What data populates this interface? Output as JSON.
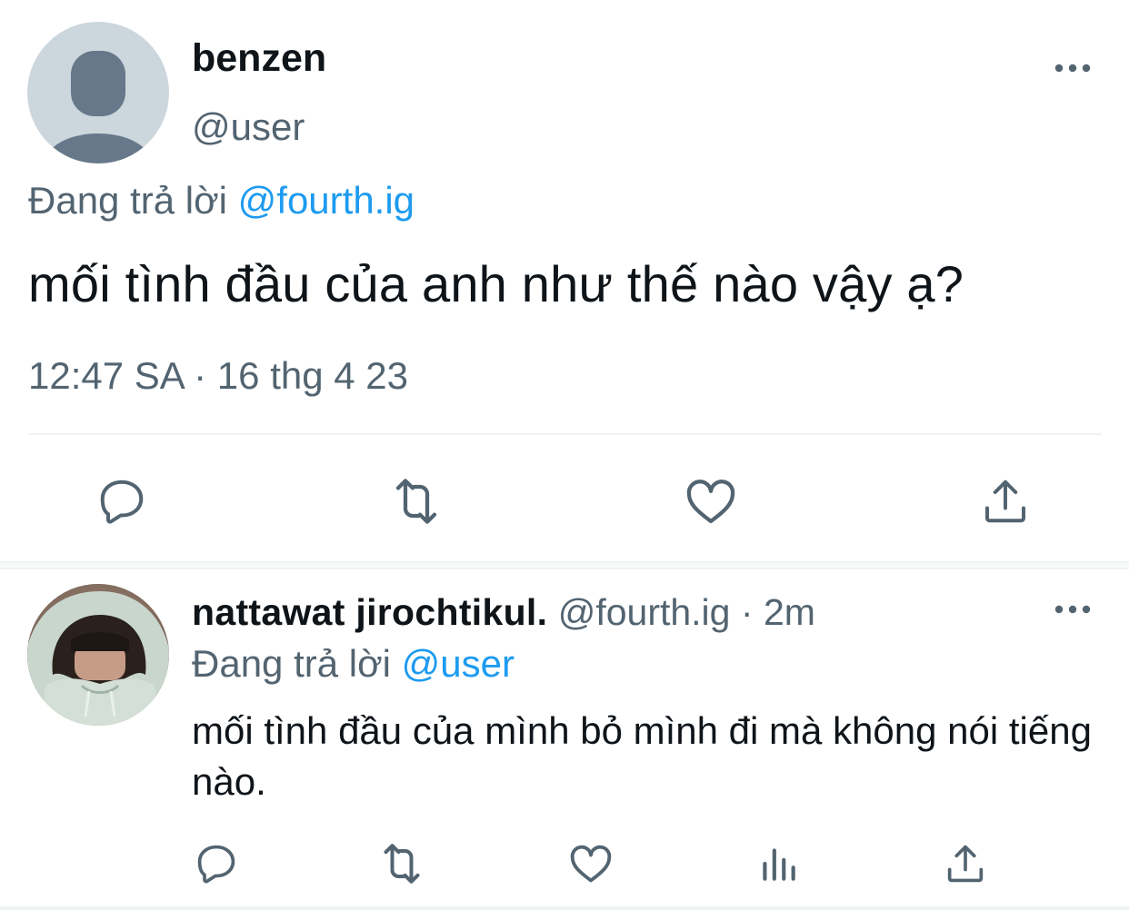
{
  "main_tweet": {
    "display_name": "benzen",
    "handle": "@user",
    "replying_prefix": "Đang trả lời",
    "replying_to": "@fourth.ig",
    "text": "mối tình đầu của anh như thế nào vậy ạ?",
    "timestamp": "12:47 SA · 16 thg 4 23",
    "avatar_icon": "default-avatar-icon",
    "actions": [
      "reply-icon",
      "retweet-icon",
      "like-icon",
      "share-icon"
    ]
  },
  "reply_tweet": {
    "display_name": "nattawat jirochtikul.",
    "handle": "@fourth.ig",
    "separator": "·",
    "time": "2m",
    "replying_prefix": "Đang trả lời",
    "replying_to": "@user",
    "text": "mối tình đầu của mình bỏ mình đi mà không nói tiếng nào.",
    "avatar_icon": "profile-photo",
    "actions": [
      "reply-icon",
      "retweet-icon",
      "like-icon",
      "views-icon",
      "share-icon"
    ]
  },
  "colors": {
    "text_primary": "#0f1419",
    "text_secondary": "#536471",
    "link": "#1d9bf0",
    "divider": "#eff3f4",
    "avatar_bg": "#ccd6dd",
    "avatar_silhouette": "#66788a"
  }
}
